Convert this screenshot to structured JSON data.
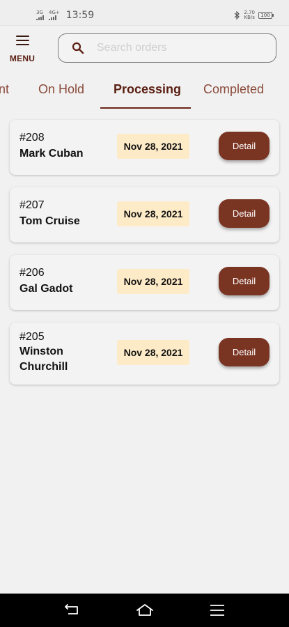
{
  "status_bar": {
    "network_1": "3G",
    "network_2": "4G+",
    "time": "13:59",
    "speed_value": "2.70",
    "speed_unit": "KB/s",
    "battery": "100"
  },
  "header": {
    "menu_label": "MENU",
    "search": {
      "placeholder": "Search orders",
      "value": ""
    }
  },
  "tabs": [
    {
      "label": "nt",
      "active": false
    },
    {
      "label": "On Hold",
      "active": false
    },
    {
      "label": "Processing",
      "active": true
    },
    {
      "label": "Completed",
      "active": false
    }
  ],
  "orders": [
    {
      "id": "#208",
      "name": "Mark Cuban",
      "date": "Nov 28, 2021",
      "action": "Detail"
    },
    {
      "id": "#207",
      "name": "Tom Cruise",
      "date": "Nov 28, 2021",
      "action": "Detail"
    },
    {
      "id": "#206",
      "name": "Gal Gadot",
      "date": "Nov 28, 2021",
      "action": "Detail"
    },
    {
      "id": "#205",
      "name": "Winston Churchill",
      "date": "Nov 28, 2021",
      "action": "Detail"
    }
  ],
  "colors": {
    "accent": "#7a3422",
    "tab_active": "#5a1f12",
    "tab_inactive": "#8a4a3a",
    "date_badge_bg": "#fdebc8",
    "background": "#f1f1f1"
  },
  "icons": {
    "menu": "hamburger-icon",
    "search": "search-icon",
    "nav_back": "back-icon",
    "nav_home": "home-icon",
    "nav_recents": "recents-icon"
  }
}
